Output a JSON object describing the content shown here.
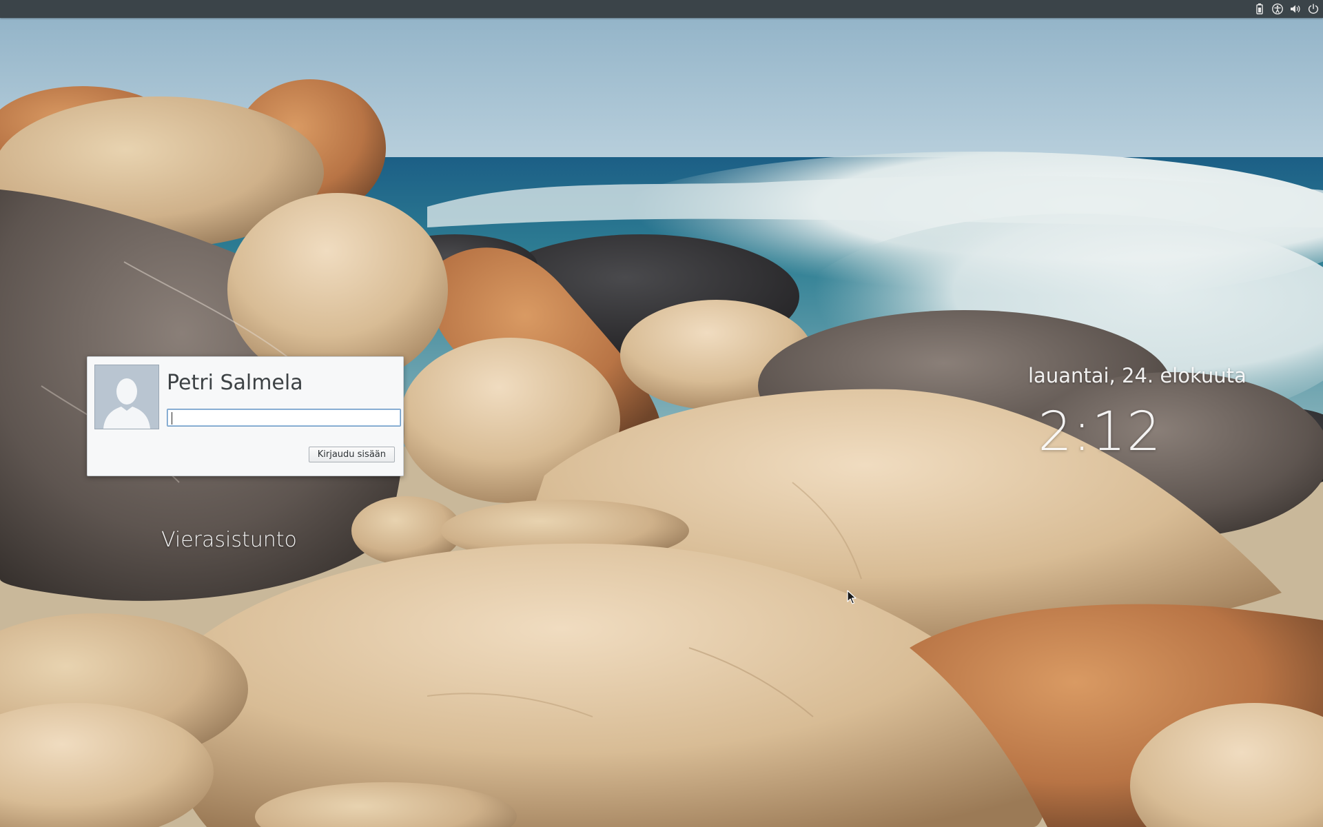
{
  "login": {
    "user_name": "Petri Salmela",
    "password_value": "",
    "login_button_label": "Kirjaudu sisään"
  },
  "guest_session_label": "Vierasistunto",
  "clock": {
    "date": "lauantai, 24. elokuuta",
    "time": "2:12"
  },
  "top_panel": {
    "indicators": [
      "battery-icon",
      "accessibility-icon",
      "volume-icon",
      "power-icon"
    ]
  },
  "colors": {
    "panel_bg": "#3b4449",
    "card_bg": "#f7f8f9",
    "input_focus_border": "#6f9ac4"
  }
}
